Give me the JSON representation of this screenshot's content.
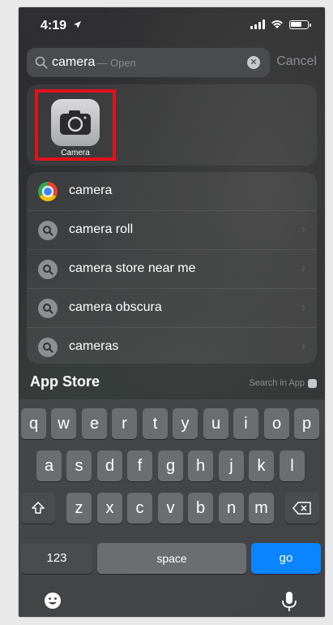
{
  "status_bar": {
    "time": "4:19",
    "battery_level": 0.7
  },
  "search": {
    "query": "camera",
    "suffix": "— Open",
    "cancel_label": "Cancel"
  },
  "top_hit": {
    "app_name": "Camera"
  },
  "suggestions": [
    {
      "label": "camera",
      "icon": "chrome-icon"
    },
    {
      "label": "camera roll",
      "icon": "search-icon"
    },
    {
      "label": "camera store near me",
      "icon": "search-icon"
    },
    {
      "label": "camera obscura",
      "icon": "search-icon"
    },
    {
      "label": "cameras",
      "icon": "search-icon"
    }
  ],
  "app_store": {
    "title": "App Store",
    "search_in_app": "Search in App"
  },
  "keyboard": {
    "row1": [
      "q",
      "w",
      "e",
      "r",
      "t",
      "y",
      "u",
      "i",
      "o",
      "p"
    ],
    "row2": [
      "a",
      "s",
      "d",
      "f",
      "g",
      "h",
      "j",
      "k",
      "l"
    ],
    "row3": [
      "z",
      "x",
      "c",
      "v",
      "b",
      "n",
      "m"
    ],
    "numbers_label": "123",
    "space_label": "space",
    "go_label": "go"
  },
  "colors": {
    "accent": "#0a84ff",
    "highlight": "#e3111b"
  }
}
